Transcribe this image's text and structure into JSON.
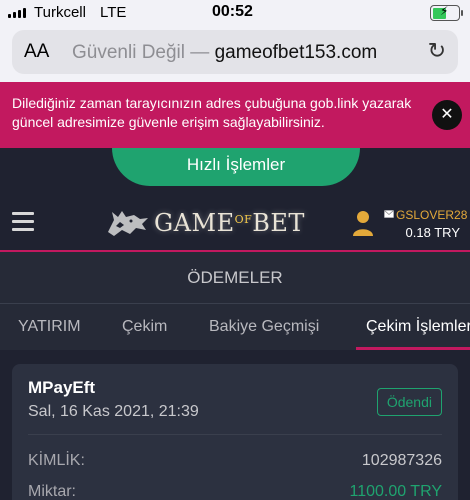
{
  "status_bar": {
    "carrier": "Turkcell",
    "network": "LTE",
    "time": "00:52"
  },
  "browser": {
    "aa_label": "AA",
    "url_prefix": "Güvenli Değil — ",
    "url_host": "gameofbet153.com"
  },
  "banner": {
    "text": "Dilediğiniz zaman tarayıcınızın adres çubuğuna gob.link yazarak güncel adresimize güvenle erişim sağlayabilirsiniz.",
    "close_label": "✕"
  },
  "quick_actions": {
    "label": "Hızlı İşlemler"
  },
  "header": {
    "logo_text_a": "GAME",
    "logo_text_of": "OF",
    "logo_text_b": "BET",
    "username": "GSLOVER28",
    "balance": "0.18 TRY"
  },
  "page_title": "ÖDEMELER",
  "tabs": [
    {
      "label": "YATIRIM"
    },
    {
      "label": "Çekim"
    },
    {
      "label": "Bakiye Geçmişi"
    },
    {
      "label": "Çekim İşlemleri"
    }
  ],
  "transaction": {
    "method": "MPayEft",
    "date": "Sal, 16 Kas 2021, 21:39",
    "status": "Ödendi",
    "rows": [
      {
        "label": "KİMLİK:",
        "value": "102987326"
      },
      {
        "label": "Miktar:",
        "value": "1100.00 TRY"
      }
    ]
  },
  "colors": {
    "accent_pink": "#c2195f",
    "accent_green": "#1fa36f",
    "background": "#1f2230"
  }
}
